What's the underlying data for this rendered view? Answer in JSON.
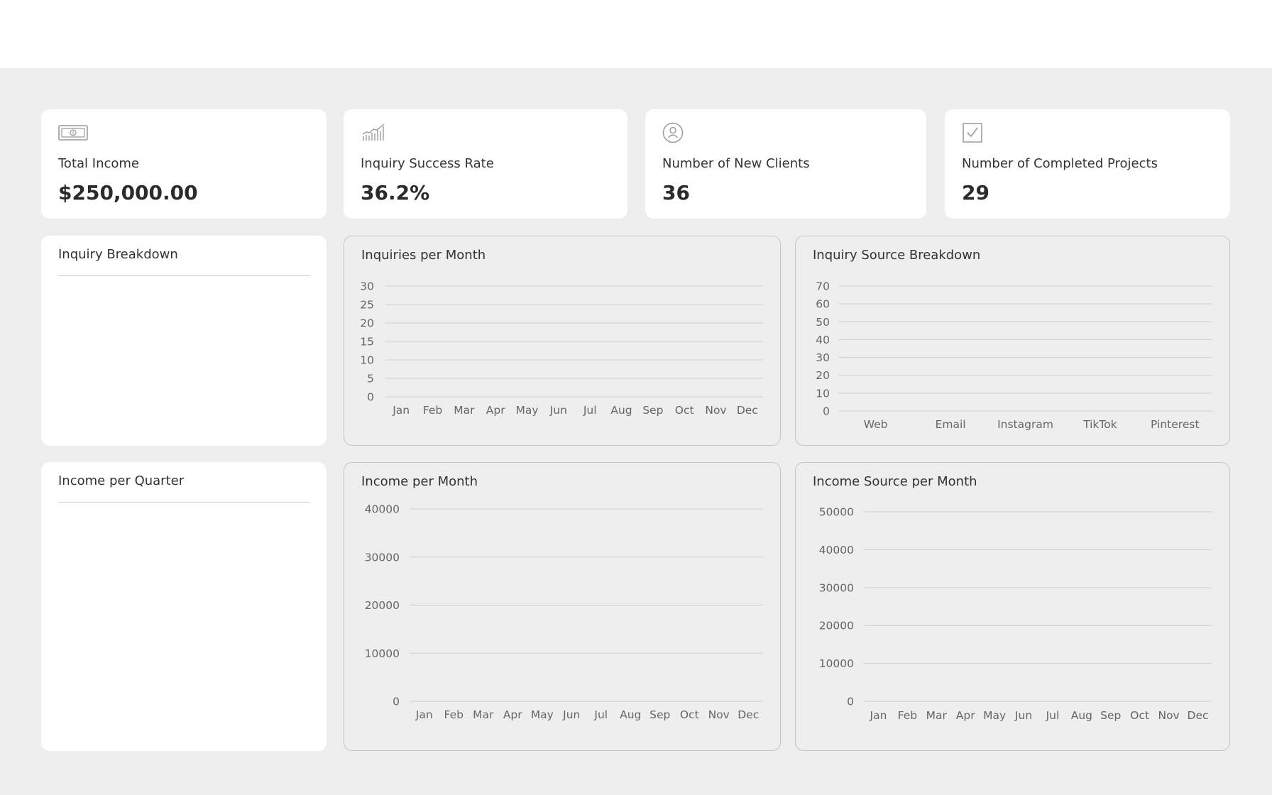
{
  "kpis": [
    {
      "label": "Total Income",
      "value": "$250,000.00",
      "icon": "banknote-icon"
    },
    {
      "label": "Inquiry Success Rate",
      "value": "36.2%",
      "icon": "growth-chart-icon"
    },
    {
      "label": "Number of New Clients",
      "value": "36",
      "icon": "user-circle-icon"
    },
    {
      "label": "Number of Completed Projects",
      "value": "29",
      "icon": "checkbox-icon"
    }
  ],
  "panels": {
    "inquiry_breakdown": {
      "title": "Inquiry Breakdown"
    },
    "income_per_quarter": {
      "title": "Income per Quarter"
    }
  },
  "chart_data": [
    {
      "type": "line",
      "title": "Inquiries per Month",
      "categories": [
        "Jan",
        "Feb",
        "Mar",
        "Apr",
        "May",
        "Jun",
        "Jul",
        "Aug",
        "Sep",
        "Oct",
        "Nov",
        "Dec"
      ],
      "y_ticks": [
        0,
        5,
        10,
        15,
        20,
        25,
        30
      ],
      "ylim": [
        0,
        30
      ],
      "series": [],
      "grid": true
    },
    {
      "type": "bar",
      "title": "Inquiry Source Breakdown",
      "categories": [
        "Web",
        "Email",
        "Instagram",
        "TikTok",
        "Pinterest"
      ],
      "y_ticks": [
        0,
        10,
        20,
        30,
        40,
        50,
        60,
        70
      ],
      "ylim": [
        0,
        70
      ],
      "series": [],
      "grid": true
    },
    {
      "type": "line",
      "title": "Income per Month",
      "categories": [
        "Jan",
        "Feb",
        "Mar",
        "Apr",
        "May",
        "Jun",
        "Jul",
        "Aug",
        "Sep",
        "Oct",
        "Nov",
        "Dec"
      ],
      "y_ticks": [
        0,
        10000,
        20000,
        30000,
        40000
      ],
      "ylim": [
        0,
        40000
      ],
      "series": [],
      "grid": true
    },
    {
      "type": "bar",
      "title": "Income Source per Month",
      "categories": [
        "Jan",
        "Feb",
        "Mar",
        "Apr",
        "May",
        "Jun",
        "Jul",
        "Aug",
        "Sep",
        "Oct",
        "Nov",
        "Dec"
      ],
      "y_ticks": [
        0,
        10000,
        20000,
        30000,
        40000,
        50000
      ],
      "ylim": [
        0,
        50000
      ],
      "series": [],
      "grid": true
    }
  ],
  "colors": {
    "background": "#eeeeee",
    "card": "#ffffff",
    "gridline": "#d4d4d4",
    "border": "#c4c4c4"
  }
}
